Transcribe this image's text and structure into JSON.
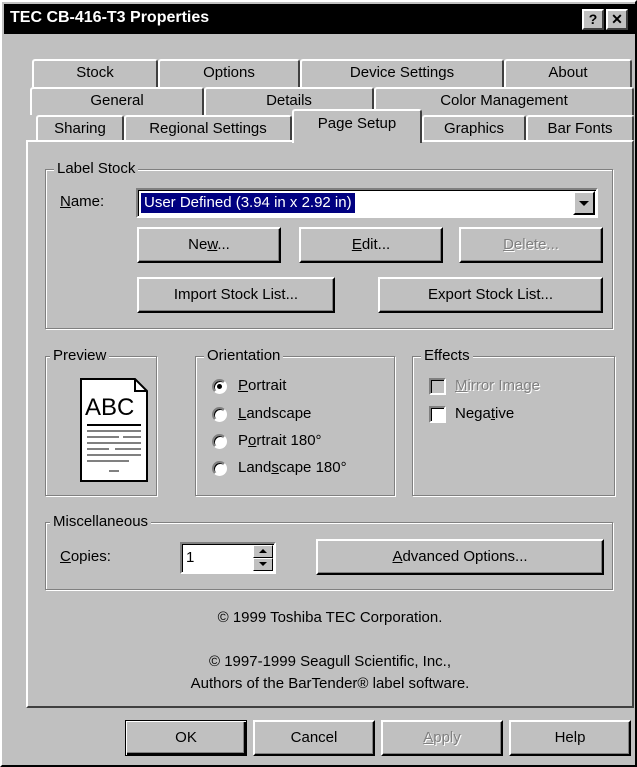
{
  "window": {
    "title": "TEC CB-416-T3 Properties",
    "help_glyph": "?",
    "close_glyph": "✕"
  },
  "tabs": {
    "row1": [
      "Stock",
      "Options",
      "Device Settings",
      "About"
    ],
    "row2": [
      "General",
      "Details",
      "Color Management"
    ],
    "row3": [
      "Sharing",
      "Regional Settings",
      "Page Setup",
      "Graphics",
      "Bar Fonts"
    ],
    "active": "Page Setup"
  },
  "label_stock": {
    "group_title": "Label Stock",
    "name_label_accel": "N",
    "name_label_rest": "ame:",
    "name_value": "User Defined (3.94 in x 2.92 in)",
    "buttons": {
      "new_pre": "Ne",
      "new_accel": "w",
      "new_post": "...",
      "edit_accel": "E",
      "edit_post": "dit...",
      "delete_accel": "D",
      "delete_post": "elete...",
      "import": "Import Stock List...",
      "export": "Export Stock List..."
    }
  },
  "preview": {
    "group_title": "Preview",
    "sample_text": "ABC"
  },
  "orientation": {
    "group_title": "Orientation",
    "options": [
      {
        "accel": "P",
        "rest": "ortrait",
        "pre": "",
        "selected": true
      },
      {
        "accel": "L",
        "rest": "andscape",
        "pre": "",
        "selected": false
      },
      {
        "accel": "o",
        "rest": "rtrait 180°",
        "pre": "P",
        "selected": false
      },
      {
        "accel": "s",
        "rest": "cape 180°",
        "pre": "Land",
        "selected": false
      }
    ]
  },
  "effects": {
    "group_title": "Effects",
    "mirror": {
      "accel": "M",
      "rest": "irror Image",
      "enabled": false,
      "checked": false
    },
    "negative": {
      "pre": "Nega",
      "accel": "t",
      "rest": "ive",
      "enabled": true,
      "checked": false
    }
  },
  "misc": {
    "group_title": "Miscellaneous",
    "copies_accel": "C",
    "copies_rest": "opies:",
    "copies_value": "1",
    "advanced_accel": "A",
    "advanced_rest": "dvanced Options..."
  },
  "copyright": {
    "line1": "© 1999 Toshiba TEC Corporation.",
    "line2": "© 1997-1999 Seagull Scientific, Inc.,",
    "line3": "Authors of the BarTender® label software."
  },
  "footer": {
    "ok": "OK",
    "cancel": "Cancel",
    "apply_accel": "A",
    "apply_rest": "pply",
    "help": "Help"
  }
}
